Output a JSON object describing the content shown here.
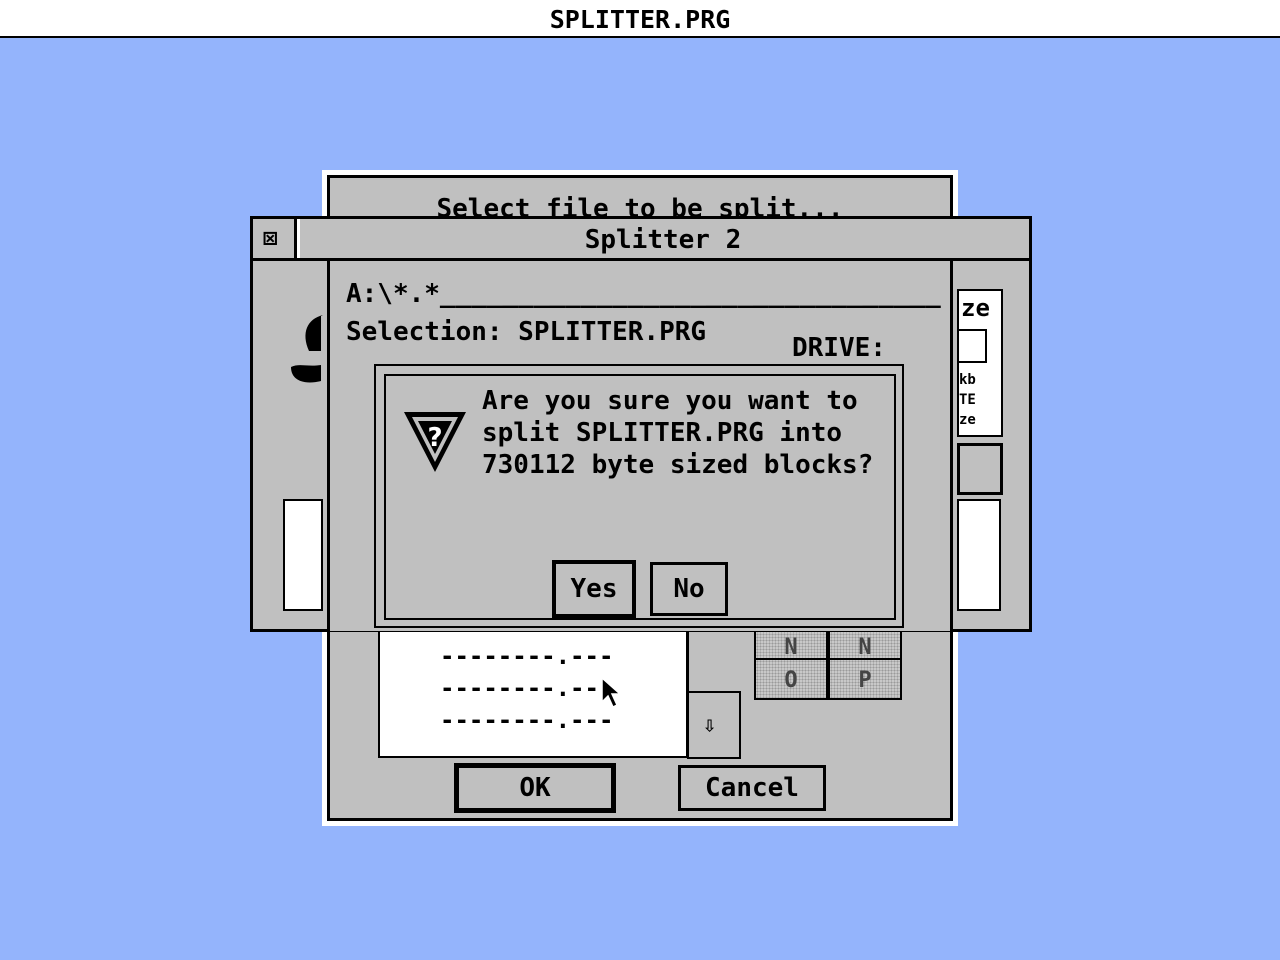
{
  "menubar": {
    "title": "SPLITTER.PRG"
  },
  "file_selector": {
    "title": "Select file to be split...",
    "path": "A:\\*.*________________________________",
    "selection_label": "Selection: SPLITTER.PRG",
    "drive_label": "DRIVE:",
    "list_rows": [
      "--------.---",
      "--------.---",
      "--------.---"
    ],
    "drives": [
      "N",
      "N",
      "O",
      "P"
    ],
    "scroll_down_icon": "⇩",
    "ok_label": "OK",
    "cancel_label": "Cancel"
  },
  "window": {
    "title": "Splitter 2",
    "close_icon": "⊠",
    "right_panel_fragments": [
      "ze",
      "kb",
      "TE",
      "ze"
    ]
  },
  "alert": {
    "icon": "question-icon",
    "lines": [
      "Are you sure you want to",
      "split SPLITTER.PRG into",
      "730112 byte sized blocks?"
    ],
    "yes_label": "Yes",
    "no_label": "No"
  }
}
